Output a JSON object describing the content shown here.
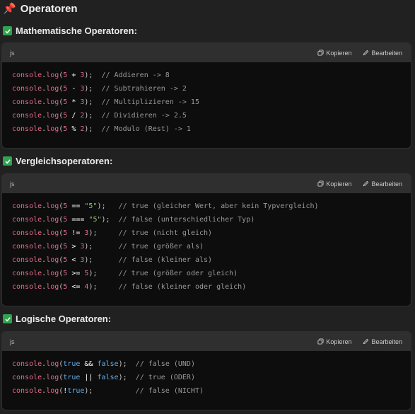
{
  "title": "Operatoren",
  "title_icon": "pushpin-icon",
  "code_lang": "js",
  "copy_label": "Kopieren",
  "edit_label": "Bearbeiten",
  "colors": {
    "background": "#212121",
    "code_bg": "#0d0d0d",
    "code_header_bg": "#2f2f2f",
    "check_green": "#2ea44f",
    "fn_color": "#e06c88",
    "string_color": "#98c379",
    "keyword_color": "#61afef",
    "comment_color": "#9a9a9a"
  },
  "sections": [
    {
      "heading": "Mathematische Operatoren:",
      "lines": [
        [
          [
            "fn",
            "console"
          ],
          [
            "punc",
            "."
          ],
          [
            "fn",
            "log"
          ],
          [
            "punc",
            "("
          ],
          [
            "num",
            "5"
          ],
          [
            "op",
            " + "
          ],
          [
            "num",
            "3"
          ],
          [
            "punc",
            ");  "
          ],
          [
            "cm",
            "// Addieren -> 8"
          ]
        ],
        [
          [
            "fn",
            "console"
          ],
          [
            "punc",
            "."
          ],
          [
            "fn",
            "log"
          ],
          [
            "punc",
            "("
          ],
          [
            "num",
            "5"
          ],
          [
            "op",
            " - "
          ],
          [
            "num",
            "3"
          ],
          [
            "punc",
            ");  "
          ],
          [
            "cm",
            "// Subtrahieren -> 2"
          ]
        ],
        [
          [
            "fn",
            "console"
          ],
          [
            "punc",
            "."
          ],
          [
            "fn",
            "log"
          ],
          [
            "punc",
            "("
          ],
          [
            "num",
            "5"
          ],
          [
            "op",
            " * "
          ],
          [
            "num",
            "3"
          ],
          [
            "punc",
            ");  "
          ],
          [
            "cm",
            "// Multiplizieren -> 15"
          ]
        ],
        [
          [
            "fn",
            "console"
          ],
          [
            "punc",
            "."
          ],
          [
            "fn",
            "log"
          ],
          [
            "punc",
            "("
          ],
          [
            "num",
            "5"
          ],
          [
            "op",
            " / "
          ],
          [
            "num",
            "2"
          ],
          [
            "punc",
            ");  "
          ],
          [
            "cm",
            "// Dividieren -> 2.5"
          ]
        ],
        [
          [
            "fn",
            "console"
          ],
          [
            "punc",
            "."
          ],
          [
            "fn",
            "log"
          ],
          [
            "punc",
            "("
          ],
          [
            "num",
            "5"
          ],
          [
            "op",
            " % "
          ],
          [
            "num",
            "2"
          ],
          [
            "punc",
            ");  "
          ],
          [
            "cm",
            "// Modulo (Rest) -> 1"
          ]
        ]
      ]
    },
    {
      "heading": "Vergleichsoperatoren:",
      "lines": [
        [
          [
            "fn",
            "console"
          ],
          [
            "punc",
            "."
          ],
          [
            "fn",
            "log"
          ],
          [
            "punc",
            "("
          ],
          [
            "num",
            "5"
          ],
          [
            "op",
            " == "
          ],
          [
            "str",
            "\"5\""
          ],
          [
            "punc",
            ");   "
          ],
          [
            "cm",
            "// true (gleicher Wert, aber kein Typvergleich)"
          ]
        ],
        [
          [
            "fn",
            "console"
          ],
          [
            "punc",
            "."
          ],
          [
            "fn",
            "log"
          ],
          [
            "punc",
            "("
          ],
          [
            "num",
            "5"
          ],
          [
            "op",
            " === "
          ],
          [
            "str",
            "\"5\""
          ],
          [
            "punc",
            ");  "
          ],
          [
            "cm",
            "// false (unterschiedlicher Typ)"
          ]
        ],
        [
          [
            "fn",
            "console"
          ],
          [
            "punc",
            "."
          ],
          [
            "fn",
            "log"
          ],
          [
            "punc",
            "("
          ],
          [
            "num",
            "5"
          ],
          [
            "op",
            " != "
          ],
          [
            "num",
            "3"
          ],
          [
            "punc",
            ");     "
          ],
          [
            "cm",
            "// true (nicht gleich)"
          ]
        ],
        [
          [
            "fn",
            "console"
          ],
          [
            "punc",
            "."
          ],
          [
            "fn",
            "log"
          ],
          [
            "punc",
            "("
          ],
          [
            "num",
            "5"
          ],
          [
            "op",
            " > "
          ],
          [
            "num",
            "3"
          ],
          [
            "punc",
            ");      "
          ],
          [
            "cm",
            "// true (größer als)"
          ]
        ],
        [
          [
            "fn",
            "console"
          ],
          [
            "punc",
            "."
          ],
          [
            "fn",
            "log"
          ],
          [
            "punc",
            "("
          ],
          [
            "num",
            "5"
          ],
          [
            "op",
            " < "
          ],
          [
            "num",
            "3"
          ],
          [
            "punc",
            ");      "
          ],
          [
            "cm",
            "// false (kleiner als)"
          ]
        ],
        [
          [
            "fn",
            "console"
          ],
          [
            "punc",
            "."
          ],
          [
            "fn",
            "log"
          ],
          [
            "punc",
            "("
          ],
          [
            "num",
            "5"
          ],
          [
            "op",
            " >= "
          ],
          [
            "num",
            "5"
          ],
          [
            "punc",
            ");     "
          ],
          [
            "cm",
            "// true (größer oder gleich)"
          ]
        ],
        [
          [
            "fn",
            "console"
          ],
          [
            "punc",
            "."
          ],
          [
            "fn",
            "log"
          ],
          [
            "punc",
            "("
          ],
          [
            "num",
            "5"
          ],
          [
            "op",
            " <= "
          ],
          [
            "num",
            "4"
          ],
          [
            "punc",
            ");     "
          ],
          [
            "cm",
            "// false (kleiner oder gleich)"
          ]
        ]
      ]
    },
    {
      "heading": "Logische Operatoren:",
      "lines": [
        [
          [
            "fn",
            "console"
          ],
          [
            "punc",
            "."
          ],
          [
            "fn",
            "log"
          ],
          [
            "punc",
            "("
          ],
          [
            "kw",
            "true"
          ],
          [
            "op",
            " && "
          ],
          [
            "kw",
            "false"
          ],
          [
            "punc",
            ");  "
          ],
          [
            "cm",
            "// false (UND)"
          ]
        ],
        [
          [
            "fn",
            "console"
          ],
          [
            "punc",
            "."
          ],
          [
            "fn",
            "log"
          ],
          [
            "punc",
            "("
          ],
          [
            "kw",
            "true"
          ],
          [
            "op",
            " || "
          ],
          [
            "kw",
            "false"
          ],
          [
            "punc",
            ");  "
          ],
          [
            "cm",
            "// true (ODER)"
          ]
        ],
        [
          [
            "fn",
            "console"
          ],
          [
            "punc",
            "."
          ],
          [
            "fn",
            "log"
          ],
          [
            "punc",
            "("
          ],
          [
            "op",
            "!"
          ],
          [
            "kw",
            "true"
          ],
          [
            "punc",
            ");          "
          ],
          [
            "cm",
            "// false (NICHT)"
          ]
        ]
      ]
    }
  ]
}
